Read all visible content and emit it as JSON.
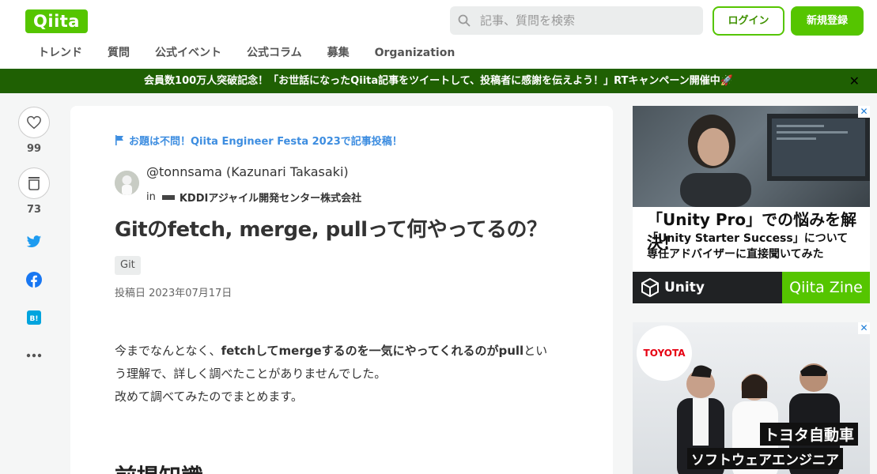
{
  "header": {
    "logo": "Qiita",
    "search_placeholder": "記事、質問を検索",
    "login_label": "ログイン",
    "signup_label": "新規登録"
  },
  "nav": [
    "トレンド",
    "質問",
    "公式イベント",
    "公式コラム",
    "募集",
    "Organization"
  ],
  "banner": {
    "text": "会員数100万人突破記念！「お世話になったQiita記事をツイートして、投稿者に感謝を伝えよう！」RTキャンペーン開催中🚀",
    "close": "✕"
  },
  "actions": {
    "like_count": "99",
    "stock_count": "73"
  },
  "article": {
    "festa": "お題は不問！Qiita Engineer Festa 2023で記事投稿！",
    "author": "@tonnsama (Kazunari Takasaki)",
    "in_label": "in",
    "org": "KDDIアジャイル開発センター株式会社",
    "title": "Gitのfetch, merge, pullって何やってるの？",
    "tag": "Git",
    "date": "投稿日 2023年07月17日",
    "p1_a": "今までなんとなく、",
    "p1_b": "fetchしてmergeするのを一気にやってくれるのがpull",
    "p1_c": "とい",
    "p1_d": "う理解で、詳しく調べたことがありませんでした。",
    "p2": "改めて調べてみたのでまとめます。",
    "h2": "前提知識"
  },
  "ad1": {
    "h1": "「Unity Pro」での悩みを解決！",
    "h2": "「Unity Starter Success」について",
    "h3": "専任アドバイザーに直接聞いてみた",
    "unity": "Unity",
    "zine": "Qiita Zine"
  },
  "ad2": {
    "logo": "TOYOTA",
    "cap1": "トヨタ自動車",
    "cap2": "ソフトウェアエンジニア"
  },
  "colors": {
    "brand": "#55c500",
    "banner": "#1f6003",
    "link": "#3d8de0"
  }
}
